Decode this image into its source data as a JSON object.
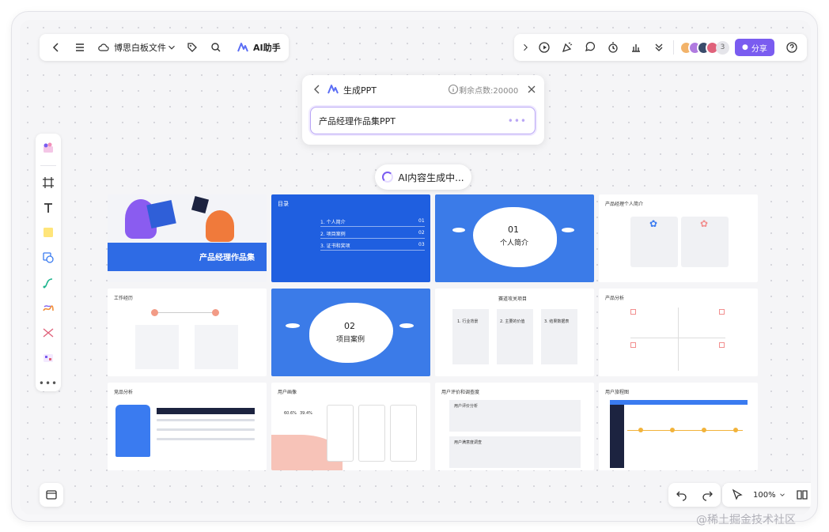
{
  "header": {
    "file_name": "博思白板文件",
    "ai_assistant_label": "AI助手",
    "collaborator_count": "3",
    "share_label": "分享"
  },
  "generator": {
    "title": "生成PPT",
    "credits": "剩余点数:20000",
    "prompt_value": "产品经理作品集PPT"
  },
  "status": {
    "generating": "AI内容生成中..."
  },
  "slides": {
    "s1_title": "产品经理作品集",
    "s2_heading": "目录",
    "s2_items": [
      {
        "label": "1. 个人简介",
        "num": "01"
      },
      {
        "label": "2. 项目案例",
        "num": "02"
      },
      {
        "label": "3. 证书和奖项",
        "num": "03"
      }
    ],
    "s3_num": "01",
    "s3_title": "个人简介",
    "s4_title": "产品经理个人简介",
    "s5_title": "工作经历",
    "s6_num": "02",
    "s6_title": "项目案例",
    "s7_title": "赛道攻关项目",
    "s7_cols": [
      "1. 行业背景",
      "2. 主要的价值",
      "3. 结果数据表"
    ],
    "s8_title": "产品分析",
    "s9_title": "竞品分析",
    "s10_title": "用户画像",
    "s10_stats": [
      "60.6%",
      "39.4%"
    ],
    "s11_title": "用户评价和调查度",
    "s11_sections": [
      "用户评价分析",
      "用户满意度调查"
    ],
    "s12_title": "用户旅程图"
  },
  "footer": {
    "zoom": "100%"
  },
  "watermark": "@稀土掘金技术社区",
  "colors": {
    "accent": "#7a5cf0",
    "slide_blue": "#3b7be8",
    "slide_deep_blue": "#1f5fe0"
  }
}
